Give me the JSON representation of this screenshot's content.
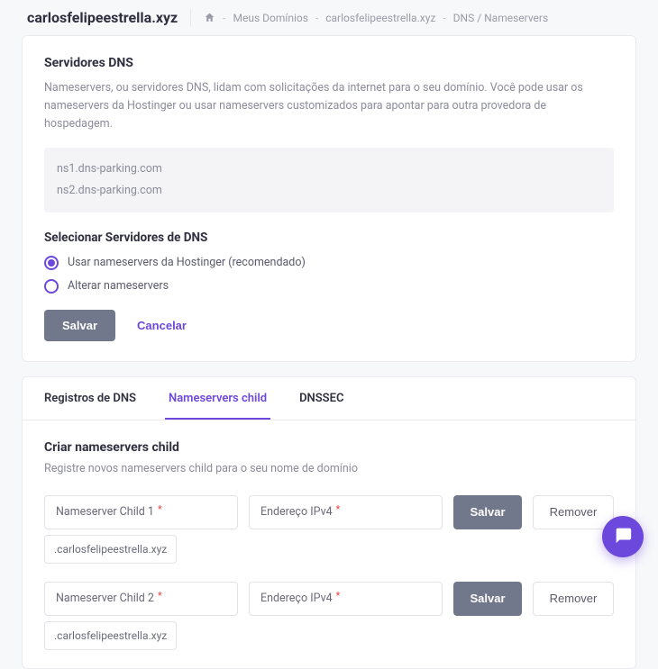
{
  "header": {
    "domain": "carlosfelipeestrella.xyz",
    "breadcrumb": {
      "mydomains": "Meus Domínios",
      "domain": "carlosfelipeestrella.xyz",
      "page": "DNS / Nameservers"
    }
  },
  "dns_card": {
    "title": "Servidores DNS",
    "description": "Nameservers, ou servidores DNS, lidam com solicitações da internet para o seu domínio. Você pode usar os nameservers da Hostinger ou usar nameservers customizados para apontar para outra provedora de hospedagem.",
    "current_ns": [
      "ns1.dns-parking.com",
      "ns2.dns-parking.com"
    ],
    "select_title": "Selecionar Servidores de DNS",
    "options": {
      "hostinger": "Usar nameservers da Hostinger (recomendado)",
      "change": "Alterar nameservers"
    },
    "save": "Salvar",
    "cancel": "Cancelar"
  },
  "tabs": {
    "dns_records": "Registros de DNS",
    "child_ns": "Nameservers child",
    "dnssec": "DNSSEC"
  },
  "child": {
    "title": "Criar nameservers child",
    "desc": "Registre novos nameservers child para o seu nome de domínio",
    "rows": [
      {
        "ns_label": "Nameserver Child 1",
        "ip_label": "Endereço IPv4",
        "suffix": ".carlosfelipeestrella.xyz"
      },
      {
        "ns_label": "Nameserver Child 2",
        "ip_label": "Endereço IPv4",
        "suffix": ".carlosfelipeestrella.xyz"
      }
    ],
    "save": "Salvar",
    "remove": "Remover"
  }
}
